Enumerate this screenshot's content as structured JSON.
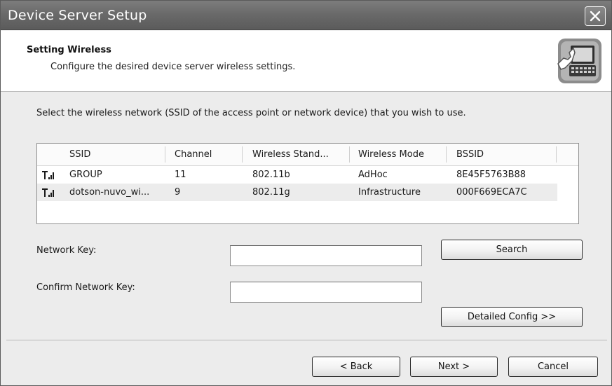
{
  "window": {
    "title": "Device Server Setup"
  },
  "header": {
    "title": "Setting Wireless",
    "subtitle": "Configure the desired device server wireless settings."
  },
  "instruction": "Select the wireless network (SSID of the access point or network device) that you wish to use.",
  "network_list": {
    "columns": [
      "SSID",
      "Channel",
      "Wireless Stand...",
      "Wireless Mode",
      "BSSID"
    ],
    "rows": [
      {
        "ssid": "GROUP",
        "channel": "11",
        "standard": "802.11b",
        "mode": "AdHoc",
        "bssid": "8E45F5763B88"
      },
      {
        "ssid": "dotson-nuvo_wi...",
        "channel": "9",
        "standard": "802.11g",
        "mode": "Infrastructure",
        "bssid": "000F669ECA7C"
      }
    ]
  },
  "form": {
    "network_key_label": "Network Key:",
    "network_key_value": "",
    "confirm_key_label": "Confirm Network Key:",
    "confirm_key_value": ""
  },
  "buttons": {
    "search": "Search",
    "detailed_config": "Detailed Config >>",
    "back": "< Back",
    "next": "Next >",
    "cancel": "Cancel"
  },
  "icons": {
    "close": "close-icon",
    "header": "network-settings-icon",
    "signal": "signal-strength-icon"
  }
}
